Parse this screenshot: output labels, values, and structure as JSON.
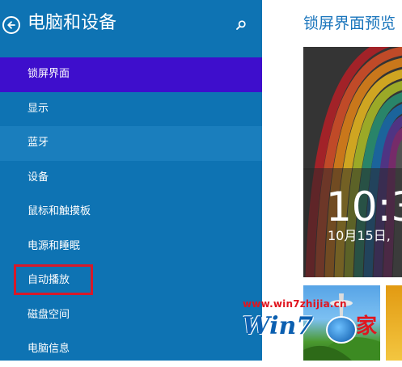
{
  "header": {
    "title": "电脑和设备",
    "back_icon": "back-arrow-icon",
    "search_icon": "search-icon"
  },
  "nav": {
    "items": [
      {
        "label": "锁屏界面"
      },
      {
        "label": "显示"
      },
      {
        "label": "蓝牙"
      },
      {
        "label": "设备"
      },
      {
        "label": "鼠标和触摸板"
      },
      {
        "label": "电源和睡眠"
      },
      {
        "label": "自动播放"
      },
      {
        "label": "磁盘空间"
      },
      {
        "label": "电脑信息"
      }
    ],
    "selected_item": "锁屏界面"
  },
  "preview": {
    "title": "锁屏界面预览",
    "time": "10:3",
    "date": "10月15日,"
  },
  "watermark": {
    "url": "www.win7zhijia.cn",
    "logo_text": "Win7",
    "logo_suffix": "家"
  },
  "colors": {
    "sidebar": "#0e73b3",
    "active_item": "#3e0ecc",
    "accent_title": "#1a75bc",
    "highlight": "#d7192a"
  }
}
